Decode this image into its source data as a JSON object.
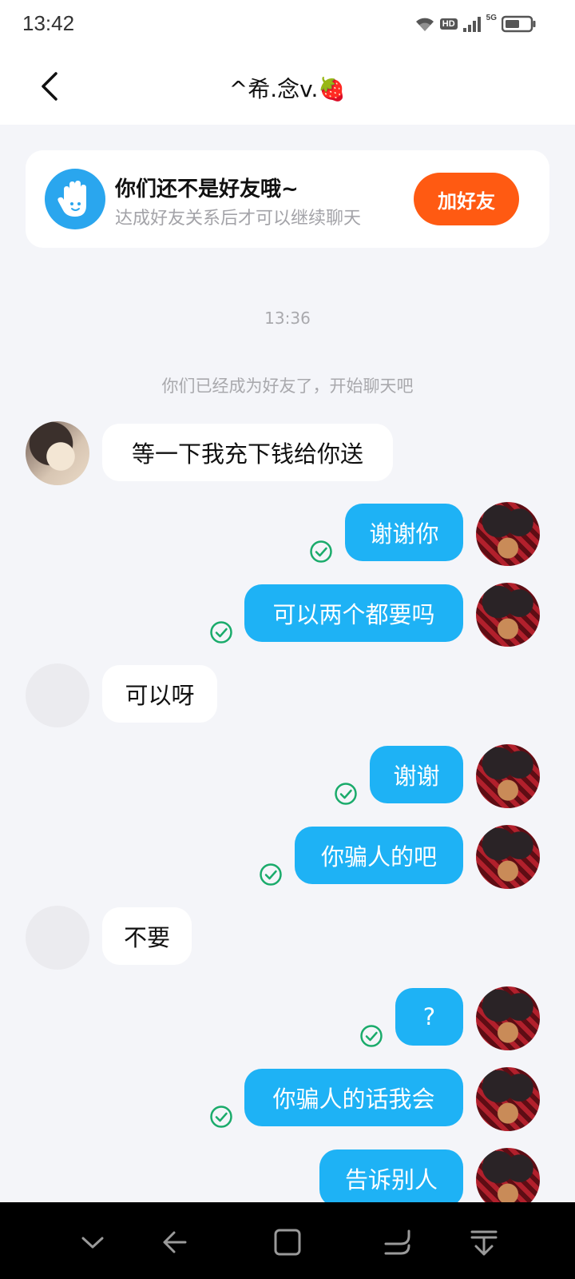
{
  "status_bar": {
    "time": "13:42",
    "hd_label": "HD",
    "network_label": "5G",
    "icons": [
      "wifi-icon",
      "signal-icon",
      "battery-icon"
    ]
  },
  "header": {
    "title": "^希.念v.🍓",
    "back_icon": "chevron-left-icon"
  },
  "friend_card": {
    "title": "你们还不是好友哦~",
    "subtitle": "达成好友关系后才可以继续聊天",
    "button_label": "加好友",
    "icon": "hand-wave-icon"
  },
  "chat": {
    "timestamp": "13:36",
    "system_message": "你们已经成为好友了，开始聊天吧",
    "messages": [
      {
        "side": "in",
        "text": "等一下我充下钱给你送"
      },
      {
        "side": "out",
        "text": "谢谢你",
        "status": "read"
      },
      {
        "side": "out",
        "text": "可以两个都要吗",
        "status": "read"
      },
      {
        "side": "in",
        "text": "可以呀"
      },
      {
        "side": "out",
        "text": "谢谢",
        "status": "read"
      },
      {
        "side": "out",
        "text": "你骗人的吧",
        "status": "read"
      },
      {
        "side": "in",
        "text": "不要"
      },
      {
        "side": "out",
        "text": "?",
        "status": "read"
      },
      {
        "side": "out",
        "text": "你骗人的话我会",
        "status": "read"
      },
      {
        "side": "out",
        "text": "告诉别人",
        "status": "sending"
      }
    ]
  },
  "colors": {
    "accent_blue": "#1eb2f5",
    "add_button": "#ff5a12",
    "read_check": "#1aab6b",
    "background": "#f4f5f9"
  },
  "nav_bar": {
    "icons": [
      "chevron-down-icon",
      "back-arrow-icon",
      "home-square-icon",
      "recent-apps-icon",
      "notification-pull-icon"
    ]
  }
}
